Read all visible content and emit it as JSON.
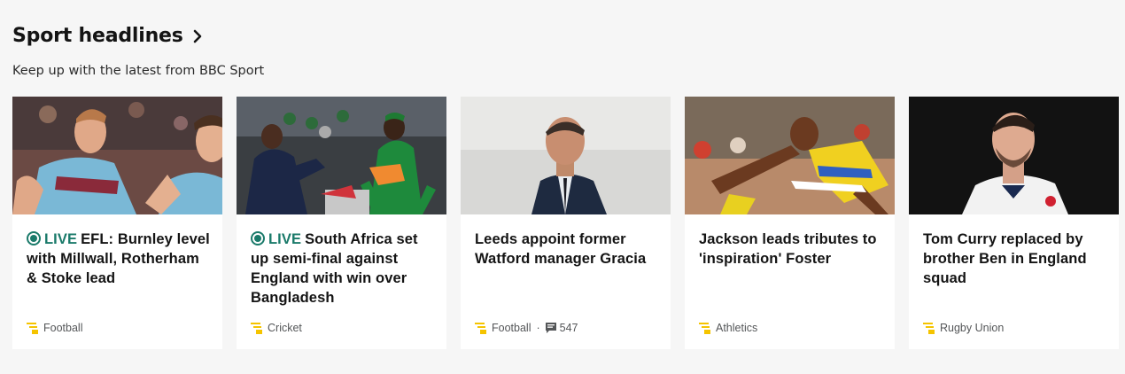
{
  "section": {
    "title": "Sport headlines",
    "subtitle": "Keep up with the latest from BBC Sport"
  },
  "cards": [
    {
      "live": true,
      "live_label": "LIVE",
      "headline": "EFL: Burnley level with Millwall, Rotherham & Stoke lead",
      "topic": "Football",
      "image": "burnley-players-celebrating"
    },
    {
      "live": true,
      "live_label": "LIVE",
      "headline": "South Africa set up semi-final against England with win over Bangladesh",
      "topic": "Cricket",
      "image": "south-africa-players-celebrating"
    },
    {
      "live": false,
      "headline": "Leeds appoint former Watford manager Gracia",
      "topic": "Football",
      "comments": "547",
      "image": "manager-in-suit"
    },
    {
      "live": false,
      "headline": "Jackson leads tributes to 'inspiration' Foster",
      "topic": "Athletics",
      "image": "hurdler-in-yellow"
    },
    {
      "live": false,
      "headline": "Tom Curry replaced by brother Ben in England squad",
      "topic": "Rugby Union",
      "image": "rugby-player-england-shirt"
    }
  ],
  "colors": {
    "live": "#1a7a6a",
    "topic_icon": "#f5c400",
    "background": "#f6f6f6"
  },
  "icons": {
    "header_chevron": "chevron-right-icon",
    "live": "live-dot-icon",
    "topic": "topic-tag-icon",
    "comments": "comment-bubble-icon"
  }
}
